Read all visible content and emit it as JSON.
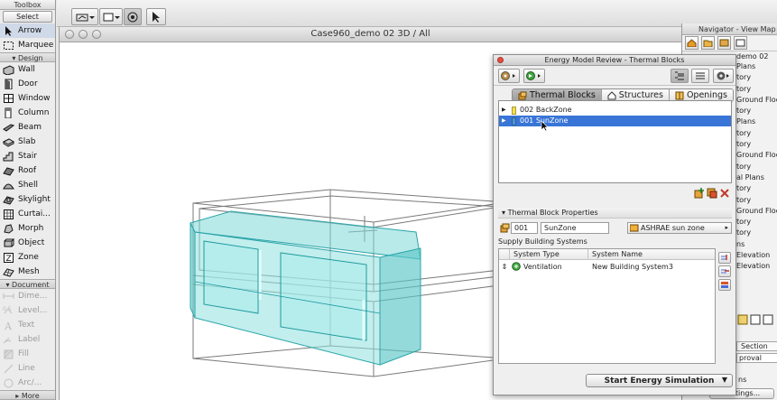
{
  "toolbox": {
    "title": "Toolbox",
    "select_label": "Select",
    "select_items": [
      {
        "label": "Arrow",
        "icon": "arrow-icon",
        "active": true
      },
      {
        "label": "Marquee",
        "icon": "marquee-icon",
        "active": false
      }
    ],
    "design_label": "Design",
    "design_items": [
      {
        "label": "Wall",
        "icon": "wall-icon"
      },
      {
        "label": "Door",
        "icon": "door-icon"
      },
      {
        "label": "Window",
        "icon": "window-icon"
      },
      {
        "label": "Column",
        "icon": "column-icon"
      },
      {
        "label": "Beam",
        "icon": "beam-icon"
      },
      {
        "label": "Slab",
        "icon": "slab-icon"
      },
      {
        "label": "Stair",
        "icon": "stair-icon"
      },
      {
        "label": "Roof",
        "icon": "roof-icon"
      },
      {
        "label": "Shell",
        "icon": "shell-icon"
      },
      {
        "label": "Skylight",
        "icon": "skylight-icon"
      },
      {
        "label": "Curtai...",
        "icon": "curtain-wall-icon"
      },
      {
        "label": "Morph",
        "icon": "morph-icon"
      },
      {
        "label": "Object",
        "icon": "object-icon"
      },
      {
        "label": "Zone",
        "icon": "zone-icon"
      },
      {
        "label": "Mesh",
        "icon": "mesh-icon"
      }
    ],
    "document_label": "Document",
    "document_items": [
      {
        "label": "Dime...",
        "icon": "dimension-icon"
      },
      {
        "label": "Level...",
        "icon": "level-dimension-icon"
      },
      {
        "label": "Text",
        "icon": "text-icon"
      },
      {
        "label": "Label",
        "icon": "label-icon"
      },
      {
        "label": "Fill",
        "icon": "fill-icon"
      },
      {
        "label": "Line",
        "icon": "line-icon"
      },
      {
        "label": "Arc/...",
        "icon": "arc-icon"
      }
    ],
    "more_label": "More"
  },
  "window3d": {
    "title": "Case960_demo 02 3D / All"
  },
  "navigator": {
    "title": "Navigator - View Map",
    "header": "demo 02",
    "rows": [
      "Plans",
      "tory",
      "tory",
      "Ground Floo",
      "tory",
      "Plans",
      "tory",
      "tory",
      "Ground Floo",
      "tory",
      "al Plans",
      "tory",
      "tory",
      "Ground Floo",
      "tory",
      "tory",
      "ns",
      "Elevation",
      "Elevation"
    ],
    "section_label": "Section",
    "approval_label": "proval",
    "ns_label": "ns",
    "settings_label": "Settings..."
  },
  "energy": {
    "title": "Energy Model Review - Thermal Blocks",
    "tabs": [
      {
        "label": "Thermal Blocks",
        "icon": "thermal-block-icon",
        "active": true
      },
      {
        "label": "Structures",
        "icon": "structure-icon",
        "active": false
      },
      {
        "label": "Openings",
        "icon": "opening-icon",
        "active": false
      }
    ],
    "zones": [
      {
        "label": "002 BackZone",
        "color": "#f4e04d",
        "selected": false
      },
      {
        "label": "001 SunZone",
        "color": "#4a90d9",
        "selected": true
      }
    ],
    "properties_label": "Thermal Block Properties",
    "block_id": "001",
    "block_name": "SunZone",
    "profile": "ASHRAE sun zone",
    "supply_label": "Supply Building Systems",
    "col_system_type": "System Type",
    "col_system_name": "System Name",
    "systems": [
      {
        "type": "Ventilation",
        "name": "New Building System3"
      }
    ],
    "simulate_label": "Start Energy Simulation"
  },
  "colors": {
    "selection": "#3875d7",
    "zone_fill": "#7fd8d8",
    "zone_stroke": "#2aa5a8"
  }
}
